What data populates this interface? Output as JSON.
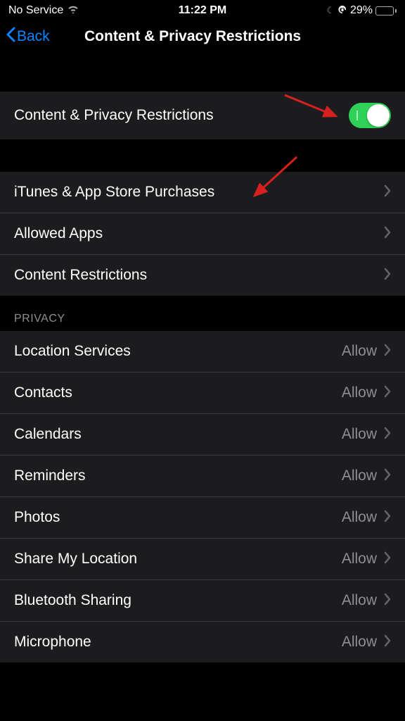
{
  "statusBar": {
    "carrier": "No Service",
    "time": "11:22 PM",
    "batteryPercent": "29%"
  },
  "nav": {
    "back": "Back",
    "title": "Content & Privacy Restrictions"
  },
  "mainToggle": {
    "label": "Content & Privacy Restrictions",
    "on": true
  },
  "restrictionRows": [
    {
      "label": "iTunes & App Store Purchases"
    },
    {
      "label": "Allowed Apps"
    },
    {
      "label": "Content Restrictions"
    }
  ],
  "privacyHeader": "PRIVACY",
  "privacyRows": [
    {
      "label": "Location Services",
      "value": "Allow"
    },
    {
      "label": "Contacts",
      "value": "Allow"
    },
    {
      "label": "Calendars",
      "value": "Allow"
    },
    {
      "label": "Reminders",
      "value": "Allow"
    },
    {
      "label": "Photos",
      "value": "Allow"
    },
    {
      "label": "Share My Location",
      "value": "Allow"
    },
    {
      "label": "Bluetooth Sharing",
      "value": "Allow"
    },
    {
      "label": "Microphone",
      "value": "Allow"
    }
  ]
}
